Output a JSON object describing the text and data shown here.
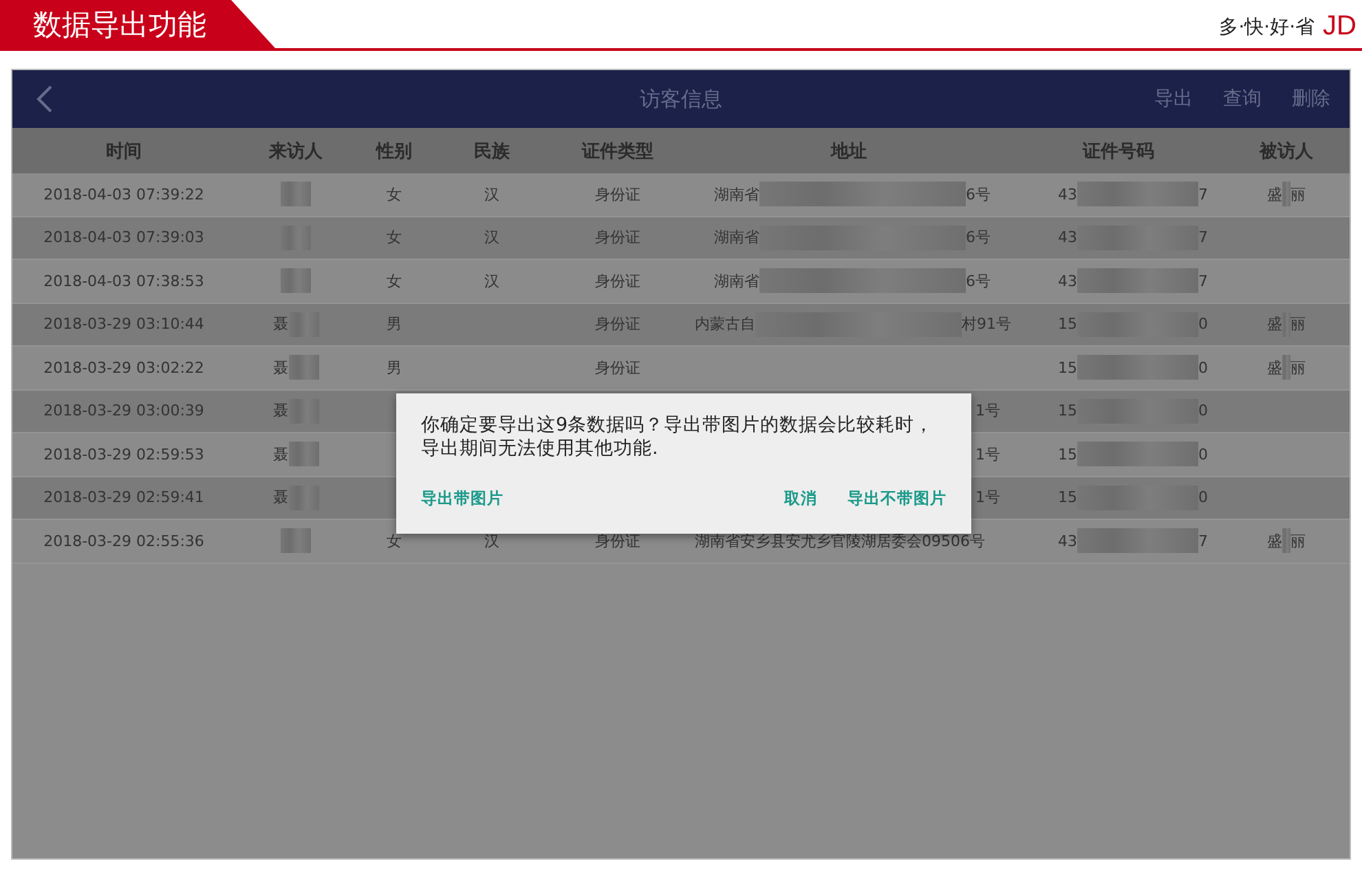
{
  "banner": {
    "title": "数据导出功能",
    "slogan": "多·快·好·省",
    "logo": "JD"
  },
  "app_bar": {
    "title": "访客信息",
    "actions": [
      "导出",
      "查询",
      "删除"
    ]
  },
  "table": {
    "columns": [
      "时间",
      "来访人",
      "性别",
      "民族",
      "证件类型",
      "地址",
      "证件号码",
      "被访人"
    ],
    "rows": [
      {
        "time": "2018-04-03 07:39:22",
        "visitor": {},
        "sex": "女",
        "nation": "汉",
        "id_type": "身份证",
        "address": {
          "before": "湖南省",
          "after": "6号"
        },
        "id_number": {
          "before": "43",
          "after": "7"
        },
        "host": {
          "before": "盛",
          "after": "丽"
        }
      },
      {
        "time": "2018-04-03 07:39:03",
        "visitor": {},
        "sex": "女",
        "nation": "汉",
        "id_type": "身份证",
        "address": {
          "before": "湖南省",
          "after": "6号"
        },
        "id_number": {
          "before": "43",
          "after": "7"
        },
        "host": {}
      },
      {
        "time": "2018-04-03 07:38:53",
        "visitor": {},
        "sex": "女",
        "nation": "汉",
        "id_type": "身份证",
        "address": {
          "before": "湖南省",
          "after": "6号"
        },
        "id_number": {
          "before": "43",
          "after": "7"
        },
        "host": {}
      },
      {
        "time": "2018-03-29 03:10:44",
        "visitor": {
          "before": "聂"
        },
        "sex": "男",
        "id_type": "身份证",
        "address": {
          "before": "内蒙古自",
          "after": "村91号"
        },
        "id_number": {
          "before": "15",
          "after": "0"
        },
        "host": {
          "before": "盛",
          "after": "丽"
        }
      },
      {
        "time": "2018-03-29 03:02:22",
        "visitor": {
          "before": "聂"
        },
        "sex": "男",
        "id_type": "身份证",
        "address": {},
        "id_number": {
          "before": "15",
          "after": "0"
        },
        "host": {
          "before": "盛",
          "after": "丽"
        }
      },
      {
        "time": "2018-03-29 03:00:39",
        "visitor": {
          "before": "聂"
        },
        "address": {
          "after": "1号"
        },
        "id_number": {
          "before": "15",
          "after": "0"
        },
        "host": {}
      },
      {
        "time": "2018-03-29 02:59:53",
        "visitor": {
          "before": "聂"
        },
        "address": {
          "after": "1号"
        },
        "id_number": {
          "before": "15",
          "after": "0"
        },
        "host": {}
      },
      {
        "time": "2018-03-29 02:59:41",
        "visitor": {
          "before": "聂"
        },
        "address": {
          "after": "1号"
        },
        "id_number": {
          "before": "15",
          "after": "0"
        },
        "host": {}
      },
      {
        "time": "2018-03-29 02:55:36",
        "visitor": {},
        "sex": "女",
        "nation": "汉",
        "id_type": "身份证",
        "address": {
          "before": "湖南省安乡县安尤乡官陵湖居委会09506号"
        },
        "id_number": {
          "before": "43",
          "after": "7"
        },
        "host": {
          "before": "盛",
          "after": "丽"
        }
      }
    ]
  },
  "dialog": {
    "message": "你确定要导出这9条数据吗？导出带图片的数据会比较耗时，导出期间无法使用其他功能.",
    "buttons": [
      "导出带图片",
      "取消",
      "导出不带图片"
    ]
  }
}
